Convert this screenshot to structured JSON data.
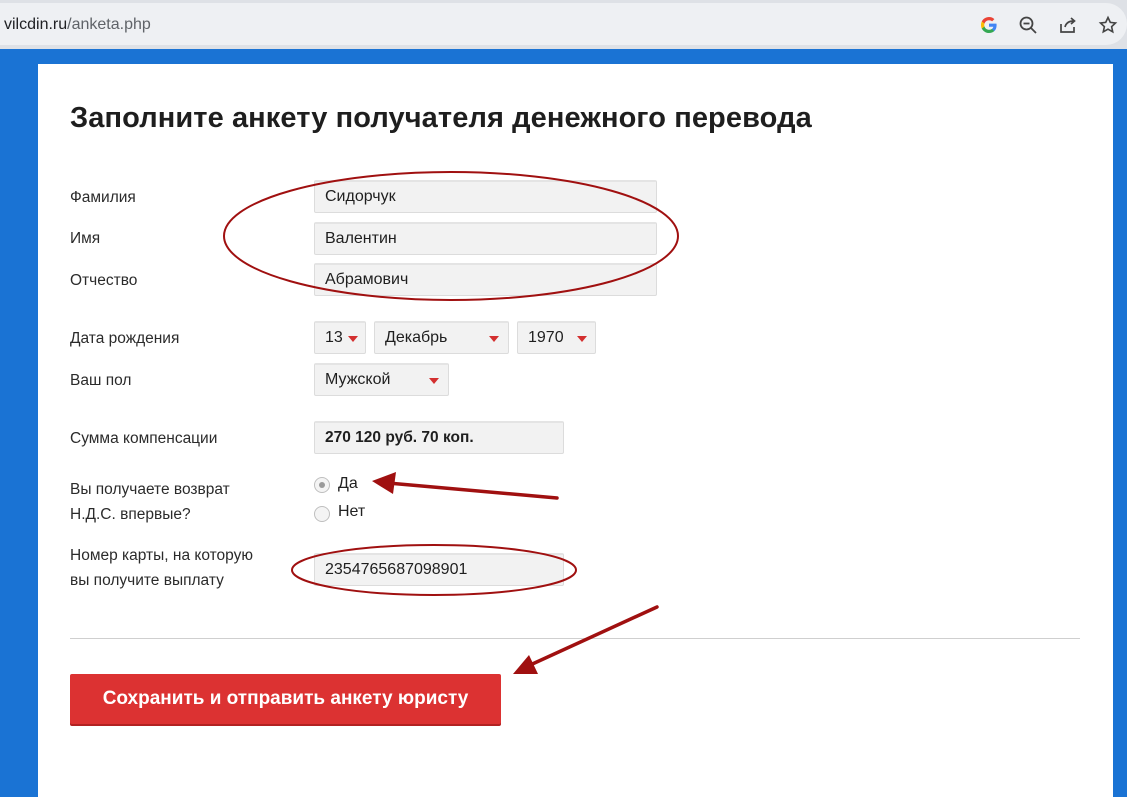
{
  "browser": {
    "url_domain": "vilcdin.ru",
    "url_path": "/anketa.php"
  },
  "form": {
    "title": "Заполните анкету получателя денежного перевода",
    "surname": {
      "label": "Фамилия",
      "value": "Сидорчук"
    },
    "name": {
      "label": "Имя",
      "value": "Валентин"
    },
    "patronymic": {
      "label": "Отчество",
      "value": "Абрамович"
    },
    "birth_date": {
      "label": "Дата рождения",
      "day": "13",
      "month": "Декабрь",
      "year": "1970"
    },
    "gender": {
      "label": "Ваш пол",
      "value": "Мужской"
    },
    "compensation": {
      "label": "Сумма компенсации",
      "value": "270 120 руб. 70 коп."
    },
    "vat_refund": {
      "label_line1": "Вы получаете возврат",
      "label_line2": "Н.Д.С. впервые?",
      "options": [
        "Да",
        "Нет"
      ],
      "selected": "Да"
    },
    "card": {
      "label_line1": "Номер карты, на которую",
      "label_line2": "вы получите выплату",
      "value": "2354765687098901"
    },
    "submit_label": "Сохранить и отправить анкету юристу"
  },
  "colors": {
    "accent_red": "#dc3232",
    "annotation_red": "#a01010",
    "frame_blue": "#1a73d4"
  },
  "icons": [
    "google-icon",
    "zoom-out-icon",
    "share-icon",
    "star-icon"
  ]
}
